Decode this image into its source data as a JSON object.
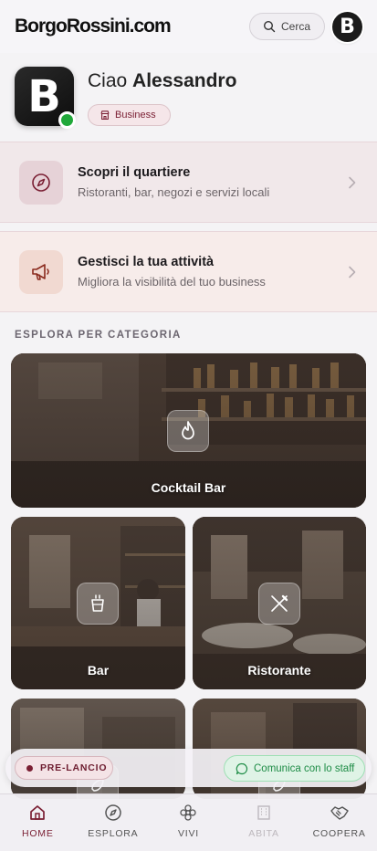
{
  "header": {
    "logo": "BorgoRossini.com",
    "search_label": "Cerca",
    "avatar_letter": "B"
  },
  "profile": {
    "avatar_letter": "B",
    "greeting_prefix": "Ciao",
    "user_name": "Alessandro",
    "role": "Business",
    "online": true
  },
  "actions": [
    {
      "title": "Scopri il quartiere",
      "subtitle": "Ristoranti, bar, negozi e servizi locali",
      "icon": "compass-icon"
    },
    {
      "title": "Gestisci la tua attività",
      "subtitle": "Migliora la visibilità del tuo business",
      "icon": "megaphone-icon"
    }
  ],
  "categories": {
    "section_title": "ESPLORA PER CATEGORIA",
    "items": [
      {
        "label": "Cocktail Bar",
        "icon": "flame-icon"
      },
      {
        "label": "Bar",
        "icon": "cup-icon"
      },
      {
        "label": "Ristorante",
        "icon": "utensils-icon"
      }
    ]
  },
  "floating": {
    "prelaunch_label": "PRE-LANCIO",
    "staff_label": "Comunica con lo staff"
  },
  "nav": [
    {
      "label": "HOME",
      "icon": "home-icon",
      "state": "active"
    },
    {
      "label": "ESPLORA",
      "icon": "compass-icon",
      "state": "normal"
    },
    {
      "label": "VIVI",
      "icon": "flower-icon",
      "state": "normal"
    },
    {
      "label": "ABITA",
      "icon": "building-icon",
      "state": "disabled"
    },
    {
      "label": "COOPERA",
      "icon": "handshake-icon",
      "state": "normal"
    }
  ],
  "colors": {
    "brand": "#7a1f33",
    "online": "#20a83a",
    "staff_green": "#1e8c46"
  }
}
